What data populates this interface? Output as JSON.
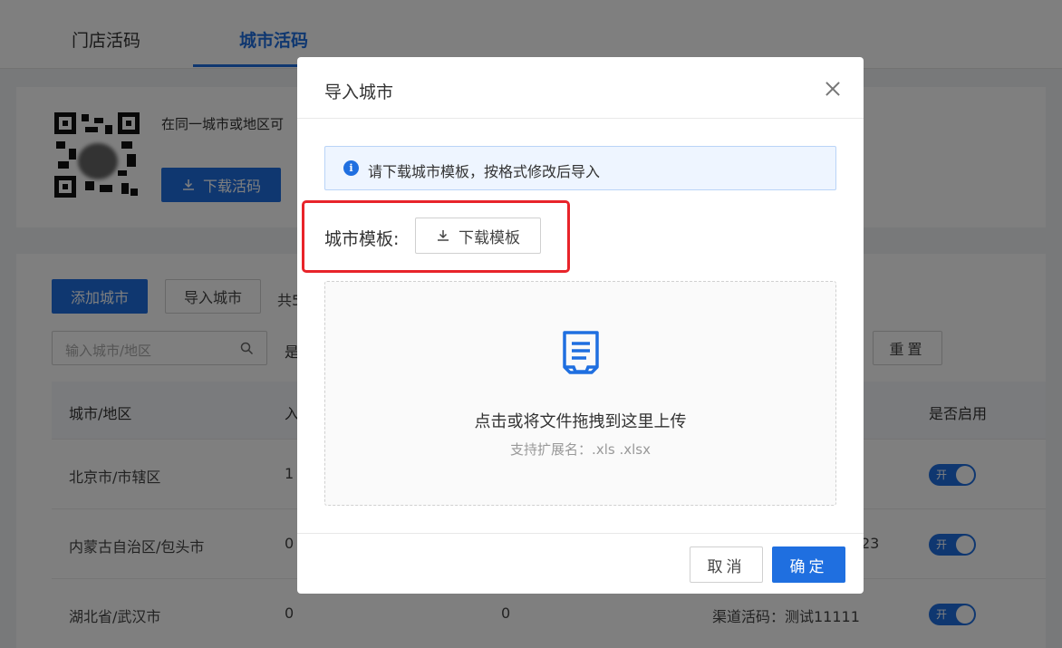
{
  "tabs": [
    {
      "label": "门店活码"
    },
    {
      "label": "城市活码"
    }
  ],
  "qr_card": {
    "description": "在同一城市或地区可",
    "download_code_label": "下载活码"
  },
  "toolbar": {
    "add_city_label": "添加城市",
    "import_city_label": "导入城市",
    "total_text": "共5",
    "search_placeholder": "输入城市/地区",
    "filter_label": "是",
    "reset_label": "重置"
  },
  "table": {
    "columns": [
      "城市/地区",
      "入",
      "是否启用"
    ],
    "rows": [
      {
        "city": "北京市/市辖区",
        "col2": "1",
        "col3": "",
        "col4": "",
        "switch_label": "开"
      },
      {
        "city": "内蒙古自治区/包头市",
        "col2": "0",
        "col3": "",
        "col4": "23",
        "switch_label": "开"
      },
      {
        "city": "湖北省/武汉市",
        "col2": "0",
        "col3": "0",
        "col4": "渠道活码：测试11111",
        "switch_label": "开"
      }
    ]
  },
  "modal": {
    "title": "导入城市",
    "alert_text": "请下载城市模板，按格式修改后导入",
    "template_label": "城市模板:",
    "download_template_label": "下载模板",
    "dropzone_text": "点击或将文件拖拽到这里上传",
    "dropzone_hint": "支持扩展名：.xls .xlsx",
    "cancel_label": "取消",
    "confirm_label": "确定"
  },
  "colors": {
    "primary": "#1f6fe0",
    "highlight": "#e8242a",
    "alert_bg": "#eef5ff"
  }
}
